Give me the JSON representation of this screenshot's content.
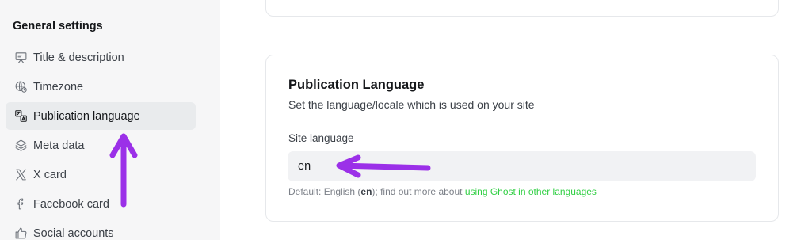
{
  "sidebar": {
    "section_title": "General settings",
    "items": [
      {
        "label": "Title & description",
        "icon": "easel-icon"
      },
      {
        "label": "Timezone",
        "icon": "globe-clock-icon"
      },
      {
        "label": "Publication language",
        "icon": "translate-icon",
        "active": true
      },
      {
        "label": "Meta data",
        "icon": "layers-icon"
      },
      {
        "label": "X card",
        "icon": "x-logo-icon"
      },
      {
        "label": "Facebook card",
        "icon": "facebook-icon"
      },
      {
        "label": "Social accounts",
        "icon": "thumbs-up-icon"
      }
    ]
  },
  "language_card": {
    "title": "Publication Language",
    "description": "Set the language/locale which is used on your site",
    "field_label": "Site language",
    "field_value": "en",
    "hint_prefix": "Default: English (",
    "hint_code": "en",
    "hint_middle": "); find out more about ",
    "hint_link": "using Ghost in other languages"
  },
  "colors": {
    "link": "#30cf43",
    "annotation_arrow": "#9b30e8",
    "active_nav_bg": "#e9ebed"
  }
}
